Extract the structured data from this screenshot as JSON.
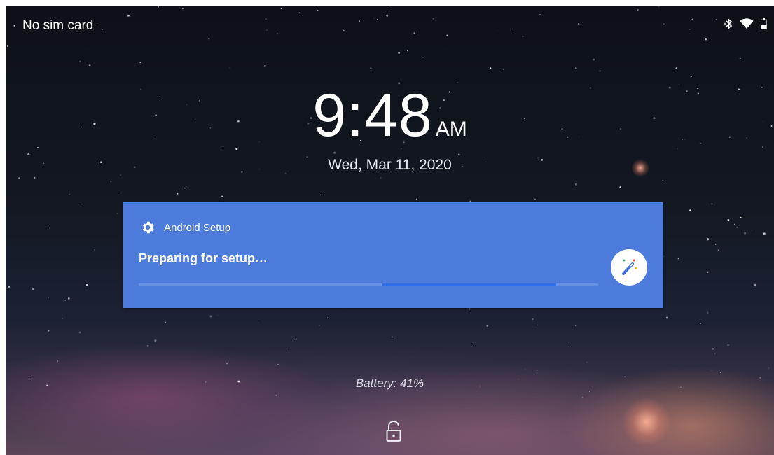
{
  "status_bar": {
    "carrier": "No sim card",
    "icons": [
      "bluetooth-icon",
      "wifi-icon",
      "battery-icon"
    ]
  },
  "lockscreen": {
    "time": "9:48",
    "ampm": "AM",
    "date": "Wed, Mar 11, 2020",
    "battery_text": "Battery: 41%"
  },
  "notification": {
    "app_name": "Android Setup",
    "title": "Preparing for setup…",
    "progress_indeterminate": true,
    "icon": "magic-wand-icon",
    "background_color": "#4d7bdb",
    "progress_color": "#2f6ee8"
  },
  "lock": {
    "icon": "unlock-icon"
  }
}
